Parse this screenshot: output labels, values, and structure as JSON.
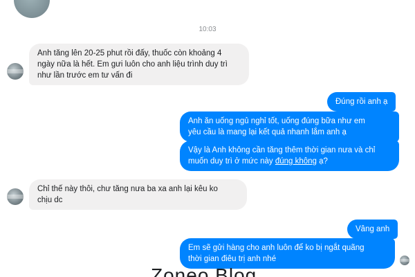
{
  "timestamp": "10:03",
  "messages": [
    {
      "id": "m1",
      "side": "incoming",
      "text": "Anh tăng lên 20-25 phut rồi đấy, thuốc còn khoảng 4\nngày nữa là hết. Em gưi luôn cho anh liệu trình duy trì\nnhư lần trước em tư vấn đi"
    },
    {
      "id": "m2",
      "side": "outgoing",
      "text": "Đúng rồi anh ạ"
    },
    {
      "id": "m3",
      "side": "outgoing",
      "text": "Anh ăn uống ngủ nghỉ tốt, uống đúng bữa như em\nyêu cầu là mang lại kết quả nhanh lắm anh ạ"
    },
    {
      "id": "m4",
      "side": "outgoing",
      "text_before": "Vậy là Anh không cần tăng thêm thời gian nưa và chỉ\nmuốn duy trì ở mức này ",
      "link": "đúng không",
      "text_after": " ạ?"
    },
    {
      "id": "m5",
      "side": "incoming",
      "text": "Chỉ thế này thôi, chư tăng nưa ba xa anh lại kêu ko\nchịu dc"
    },
    {
      "id": "m6",
      "side": "outgoing",
      "text": "Vâng anh"
    },
    {
      "id": "m7",
      "side": "outgoing",
      "text": "Em sẽ gửi hàng cho anh luôn để ko bị ngắt quãng\nthời gian điêu trị anh nhé"
    }
  ],
  "watermark": "Zoneo Blog"
}
